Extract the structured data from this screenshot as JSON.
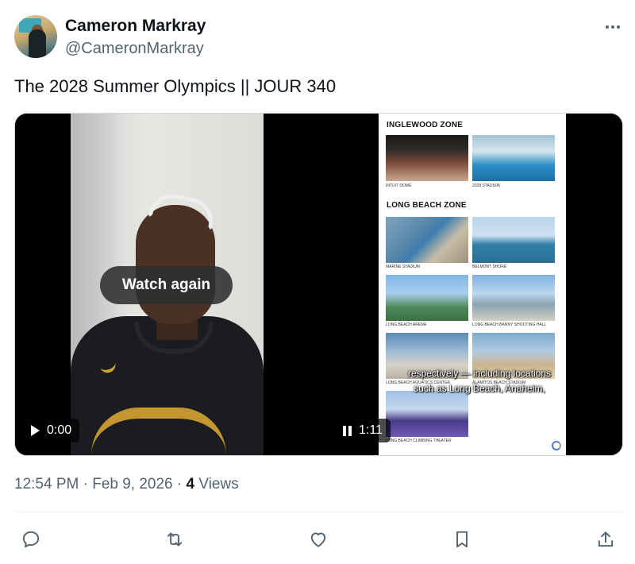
{
  "author": {
    "name": "Cameron Markray",
    "handle": "@CameronMarkray"
  },
  "post": {
    "text": "The 2028 Summer Olympics || JOUR 340",
    "timestamp": "12:54 PM · Feb 9, 2026",
    "separator": "·",
    "views_count": "4",
    "views_label": "Views"
  },
  "videos": [
    {
      "overlay_label": "Watch again",
      "time": "0:00",
      "state_icon": "play-icon"
    },
    {
      "time": "1:11",
      "state_icon": "pause-icon",
      "subtitle_line1": "respectively — including locations",
      "subtitle_line2": "such as Long Beach, Anaheim,",
      "doc": {
        "zone1_title": "INGLEWOOD ZONE",
        "zone1_captions": [
          "INTUIT DOME",
          "2028 STADIUM"
        ],
        "zone2_title": "LONG BEACH ZONE",
        "zone2_captions": [
          "MARINE STADIUM",
          "BELMONT SHORE",
          "LONG BEACH ARENA",
          "LONG BEACH BANNY SHOOTING HALL",
          "LONG BEACH AQUATICS CENTER",
          "ALAMITOS BEACH STADIUM",
          "LONG BEACH CLIMBING THEATER"
        ]
      }
    }
  ],
  "actions": [
    "reply-icon",
    "repost-icon",
    "like-icon",
    "bookmark-icon",
    "share-icon"
  ],
  "colors": {
    "text_primary": "#0f1419",
    "text_secondary": "#536471",
    "divider": "#eff3f4",
    "accent_gold": "#d6a431"
  }
}
